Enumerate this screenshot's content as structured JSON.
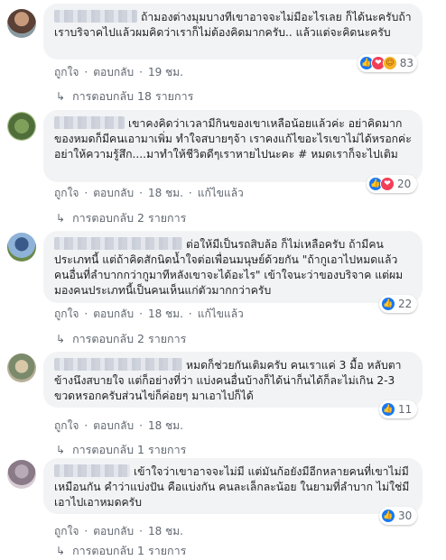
{
  "comments": [
    {
      "text": "ถ้ามองต่างมุมบางทีเขาอาจจะไม่มีอะไรเลย ก็ได้นะครับถ้าเราบริจาคไปแล้วผมคิดว่าเราก็ไม่ต้องคิดมากครับ.. แล้วแต่จะคิดนะครับ",
      "reaction_count": "83",
      "like_label": "ถูกใจ",
      "reply_label": "ตอบกลับ",
      "time": "19 ชม.",
      "edited": "",
      "replies_label": "การตอบกลับ 18 รายการ"
    },
    {
      "text": "เขาคงคิดว่าเวลามีกินของเขาเหลือน้อยแล้วค่ะ อย่าคิดมาก ของหมดก็มีคนเอามาเพิ่ม ทำใจสบายๆจ้า เราคงแก้ไขอะไรเขาไม่ได้หรอกค่ะ อย่าให้ความรู้สึก....มาทำให้ชีวิตดีๆเราหายไปนะคะ # หมดเราก็จะไปเติม",
      "reaction_count": "20",
      "like_label": "ถูกใจ",
      "reply_label": "ตอบกลับ",
      "time": "18 ชม.",
      "edited": "แก้ไขแล้ว",
      "replies_label": "การตอบกลับ 2 รายการ"
    },
    {
      "text": "ต่อให้มีเป็นรถสิบล้อ ก็ไม่เหลือครับ ถ้ามีคนประเภทนี้ แต่ถ้าคิดสักนิดน้ำใจต่อเพื่อนมนุษย์ด้วยกัน \"ถ้ากูเอาไปหมดแล้วคนอื่นที่ลำบากกว่ากูมาทีหลังเขาจะได้อะไร\" เข้าใจนะว่าของบริจาค แต่ผมมองคนประเภทนี้เป็นคนเห็นแก่ตัวมากกว่าครับ",
      "reaction_count": "22",
      "like_label": "ถูกใจ",
      "reply_label": "ตอบกลับ",
      "time": "18 ชม.",
      "edited": "แก้ไขแล้ว",
      "replies_label": "การตอบกลับ 2 รายการ"
    },
    {
      "text": "หมดก็ช่วยกันเติมครับ คนเราแค่ 3 มื้อ หลับตาข้างนึงสบายใจ แต่ก็อย่างที่ว่า แบ่งคนอื่นบ้างก็ได้น่าก็นได้ก็ละไม่เกิน 2-3 ขวดหรอกครับส่วนไข่ก็ค่อยๆ มาเอาไปก็ได้",
      "reaction_count": "11",
      "like_label": "ถูกใจ",
      "reply_label": "ตอบกลับ",
      "time": "18 ชม.",
      "edited": "",
      "replies_label": "การตอบกลับ 1 รายการ"
    },
    {
      "text": "เข้าใจว่าเขาอาจจะไม่มี แต่มันก้อยังมีอีกหลายคนที่เขาไม่มีเหมือนกัน คำว่าแบ่งปัน คือแบ่งกัน คนละเล็กละน้อย ในยามที่ลำบาก ไม่ใช่มีเอาไปเอาหมดครับ",
      "reaction_count": "30",
      "like_label": "ถูกใจ",
      "reply_label": "ตอบกลับ",
      "time": "18 ชม.",
      "edited": "",
      "replies_label": "การตอบกลับ 1 รายการ"
    }
  ],
  "colors": {
    "bubble": "#f2f3f5",
    "like_blue": "#1877f2",
    "love_red": "#f33e58",
    "care_yellow": "#f7b125",
    "meta_gray": "#606770"
  },
  "icons": {
    "like": "like-icon",
    "love": "love-icon",
    "care": "care-icon",
    "reply_arrow": "reply-arrow-icon"
  }
}
